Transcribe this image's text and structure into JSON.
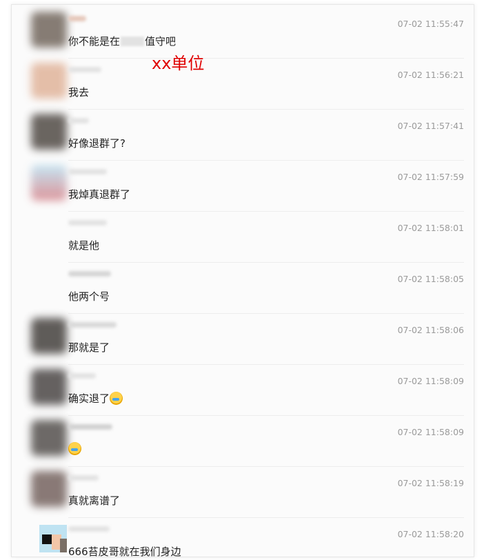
{
  "annotation": "xx单位",
  "messages": [
    {
      "text_before": "你不能是在",
      "text_after": "值守吧",
      "time": "07-02 11:55:47",
      "avatar": "#7a6f66"
    },
    {
      "text": "我去",
      "time": "07-02 11:56:21",
      "avatar": "#e2b8a0"
    },
    {
      "text": "好像退群了?",
      "time": "07-02 11:57:41",
      "avatar": "#5b5550"
    },
    {
      "text": "我焯真退群了",
      "time": "07-02 11:57:59",
      "avatar": "#d98a90"
    },
    {
      "text": "就是他",
      "time": "07-02 11:58:01",
      "avatar": ""
    },
    {
      "text": "他两个号",
      "time": "07-02 11:58:05",
      "avatar": ""
    },
    {
      "text": "那就是了",
      "time": "07-02 11:58:06",
      "avatar": "#4f4b48"
    },
    {
      "text": "确实退了",
      "time": "07-02 11:58:09",
      "avatar": "#555150"
    },
    {
      "text": "",
      "time": "07-02 11:58:09",
      "avatar": "#5e5a57"
    },
    {
      "text": "真就离谱了",
      "time": "07-02 11:58:19",
      "avatar": "#7d6c68"
    },
    {
      "text": "666苔皮哥就在我们身边",
      "time": "07-02 11:58:20",
      "avatar": "#bfe3f2"
    }
  ]
}
